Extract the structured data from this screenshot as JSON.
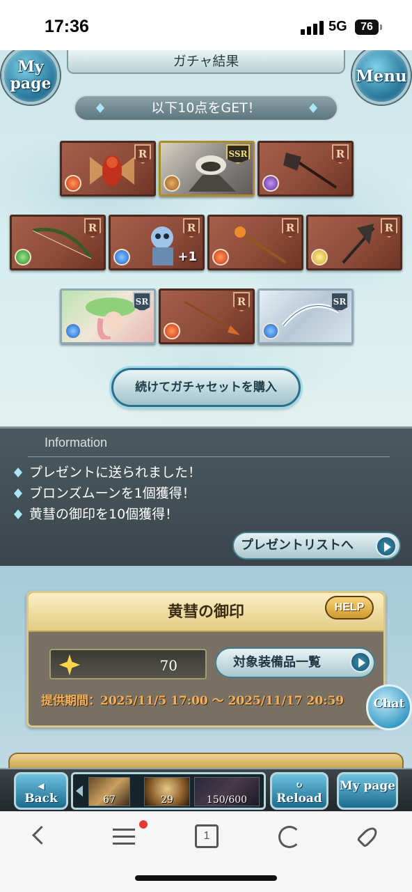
{
  "status_bar": {
    "time": "17:36",
    "network": "5G",
    "battery": "76"
  },
  "header": {
    "title": "ガチャ結果",
    "mypage_label": "My page",
    "menu_label": "Menu"
  },
  "banner": {
    "text": "以下10点をGET！"
  },
  "cards": [
    {
      "rarity": "R",
      "element": "fire",
      "subject": "armored-winged-summon"
    },
    {
      "rarity": "SSR",
      "element": "earth",
      "subject": "dark-knight-portrait"
    },
    {
      "rarity": "R",
      "element": "dark",
      "subject": "battle-axe"
    },
    {
      "rarity": "R",
      "element": "wind",
      "subject": "bow"
    },
    {
      "rarity": "R",
      "element": "water",
      "subject": "skeleton-summon",
      "plus": "+1"
    },
    {
      "rarity": "R",
      "element": "fire",
      "subject": "staff"
    },
    {
      "rarity": "R",
      "element": "light",
      "subject": "axe"
    },
    {
      "rarity": "SR",
      "element": "water",
      "subject": "green-hat-girl"
    },
    {
      "rarity": "R",
      "element": "fire",
      "subject": "spear"
    },
    {
      "rarity": "SR",
      "element": "water",
      "subject": "silver-bow"
    }
  ],
  "buy_button": {
    "label": "続けてガチャセットを購入"
  },
  "info": {
    "title": "Information",
    "lines": [
      "プレゼントに送られました！",
      "ブロンズムーンを1個獲得！",
      "黄彗の御印を10個獲得！"
    ],
    "present_button": "プレゼントリストへ"
  },
  "seal": {
    "title": "黄彗の御印",
    "help": "HELP",
    "count": "70",
    "target_button": "対象装備品一覧",
    "period": "提供期間：2025/11/5 17:00 〜 2025/11/17 20:59"
  },
  "chat": {
    "label": "Chat"
  },
  "game_nav": {
    "back": "Back",
    "reload": "Reload",
    "mypage": "My page",
    "items": [
      "67",
      "29",
      "150/600"
    ]
  },
  "browser": {
    "tabs_count": "1"
  },
  "colors": {
    "accent_blue": "#1c6b8d",
    "gold": "#e3cc86",
    "period_orange": "#f7b05a",
    "notify_red": "#e53935"
  }
}
